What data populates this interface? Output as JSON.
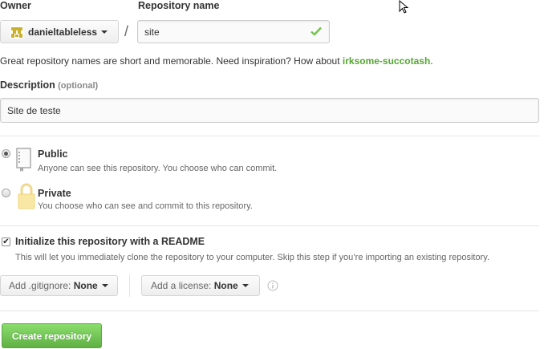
{
  "owner": {
    "label": "Owner",
    "name": "danieltableless"
  },
  "repository": {
    "label": "Repository name",
    "value": "site",
    "separator": "/"
  },
  "hint": {
    "text": "Great repository names are short and memorable. Need inspiration? How about ",
    "suggestion": "irksome-succotash",
    "end": "."
  },
  "description": {
    "label": "Description",
    "optional": "(optional)",
    "value": "Site de teste"
  },
  "visibility": {
    "public": {
      "title": "Public",
      "desc": "Anyone can see this repository. You choose who can commit.",
      "selected": true
    },
    "private": {
      "title": "Private",
      "desc": "You choose who can see and commit to this repository.",
      "selected": false
    }
  },
  "init": {
    "checked": true,
    "title": "Initialize this repository with a README",
    "desc": "This will let you immediately clone the repository to your computer. Skip this step if you’re importing an existing repository."
  },
  "gitignore": {
    "prefix": "Add .gitignore:",
    "value": "None"
  },
  "license": {
    "prefix": "Add a license:",
    "value": "None"
  },
  "submit": {
    "label": "Create repository"
  },
  "colors": {
    "success": "#6cc644",
    "button_green": "#60b044",
    "suggestion_green": "#55a532",
    "owner_avatar": "#c9b12e"
  }
}
